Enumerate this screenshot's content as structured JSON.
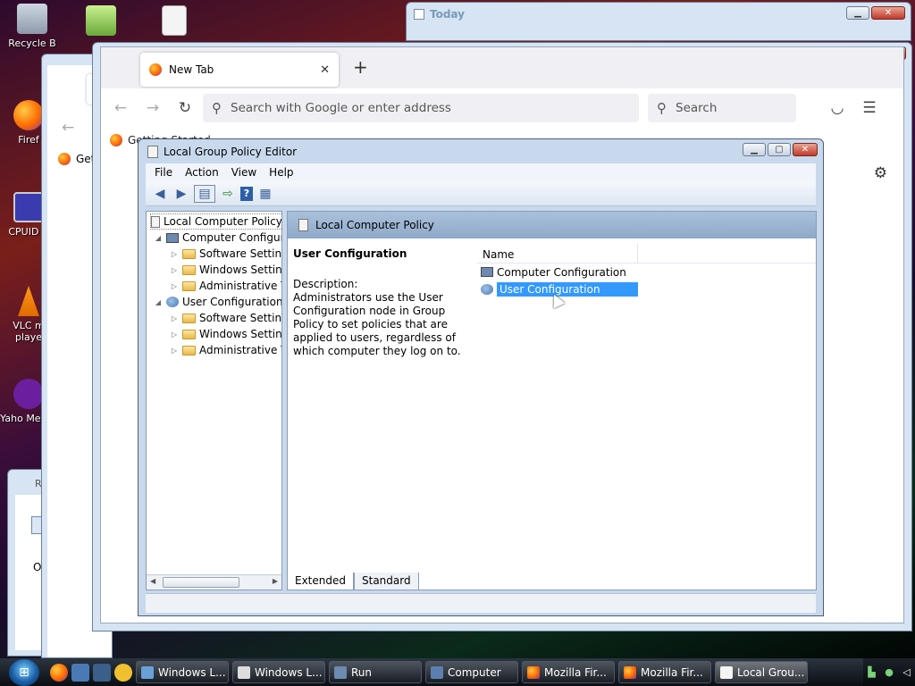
{
  "desktop": {
    "icons": [
      {
        "label": "Recycle B"
      },
      {
        "label": "Firef"
      },
      {
        "label": "CPUID C"
      },
      {
        "label": "VLC m playe"
      },
      {
        "label": "Yaho Messe"
      }
    ],
    "partial_window_title": "R",
    "partial_window_text": "Op"
  },
  "today_window": {
    "title": "Today"
  },
  "back_firefox": {
    "bookmark_label": "Get"
  },
  "firefox": {
    "tab_label": "New Tab",
    "url_placeholder": "Search with Google or enter address",
    "search_placeholder": "Search",
    "bookmark_label": "Getting Started"
  },
  "gpe": {
    "title": "Local Group Policy Editor",
    "menu": [
      "File",
      "Action",
      "View",
      "Help"
    ],
    "tree": {
      "root": "Local Computer Policy",
      "computer": "Computer Configura",
      "computer_children": [
        "Software Settings",
        "Windows Setting",
        "Administrative Te"
      ],
      "user": "User Configuration",
      "user_children": [
        "Software Settings",
        "Windows Setting",
        "Administrative Te"
      ]
    },
    "right_header": "Local Computer Policy",
    "desc_title": "User Configuration",
    "desc_label": "Description:",
    "desc_text": "Administrators use the User Configuration node in Group Policy to set policies that are applied to users, regardless of which computer they log on to.",
    "column_name": "Name",
    "items": [
      "Computer Configuration",
      "User Configuration"
    ],
    "tabs": [
      "Extended",
      "Standard"
    ]
  },
  "taskbar": {
    "tasks": [
      "Windows L...",
      "Windows L...",
      "Run",
      "Computer",
      "Mozilla Fir...",
      "Mozilla Fir...",
      "Local Grou..."
    ]
  }
}
